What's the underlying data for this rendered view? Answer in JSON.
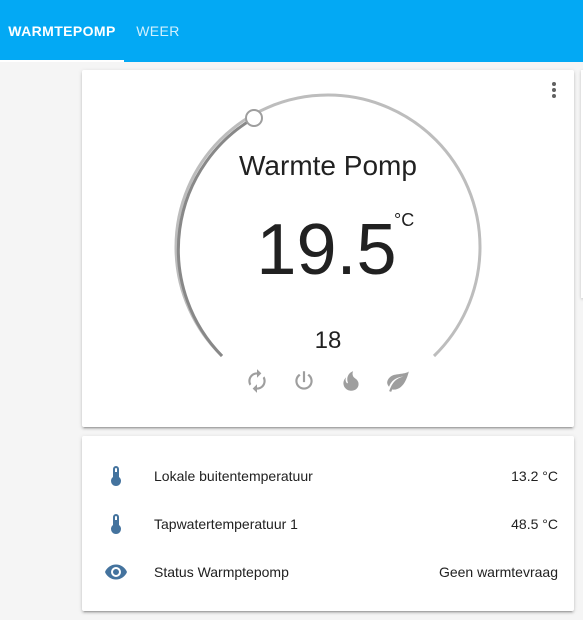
{
  "tabs": [
    {
      "label": "WARMTEPOMP",
      "active": true
    },
    {
      "label": "WEER",
      "active": false
    }
  ],
  "colors": {
    "header": "#03a9f4",
    "accent_icon": "#44739e",
    "dial_track": "#bdbdbd",
    "dial_progress": "#888888"
  },
  "thermostat": {
    "name": "Warmte Pomp",
    "current_temperature": "19.5",
    "unit": "°C",
    "target_temperature": "18",
    "menu_icon": "dots-vertical-icon",
    "modes": [
      {
        "name": "auto",
        "icon": "autorenew-icon"
      },
      {
        "name": "off",
        "icon": "power-icon"
      },
      {
        "name": "heat",
        "icon": "fire-icon"
      },
      {
        "name": "eco",
        "icon": "leaf-icon"
      }
    ]
  },
  "entities": [
    {
      "icon": "thermometer-icon",
      "label": "Lokale buitentemperatuur",
      "value": "13.2 °C"
    },
    {
      "icon": "thermometer-icon",
      "label": "Tapwatertemperatuur 1",
      "value": "48.5 °C"
    },
    {
      "icon": "eye-icon",
      "label": "Status Warmptepomp",
      "value": "Geen warmtevraag"
    }
  ]
}
